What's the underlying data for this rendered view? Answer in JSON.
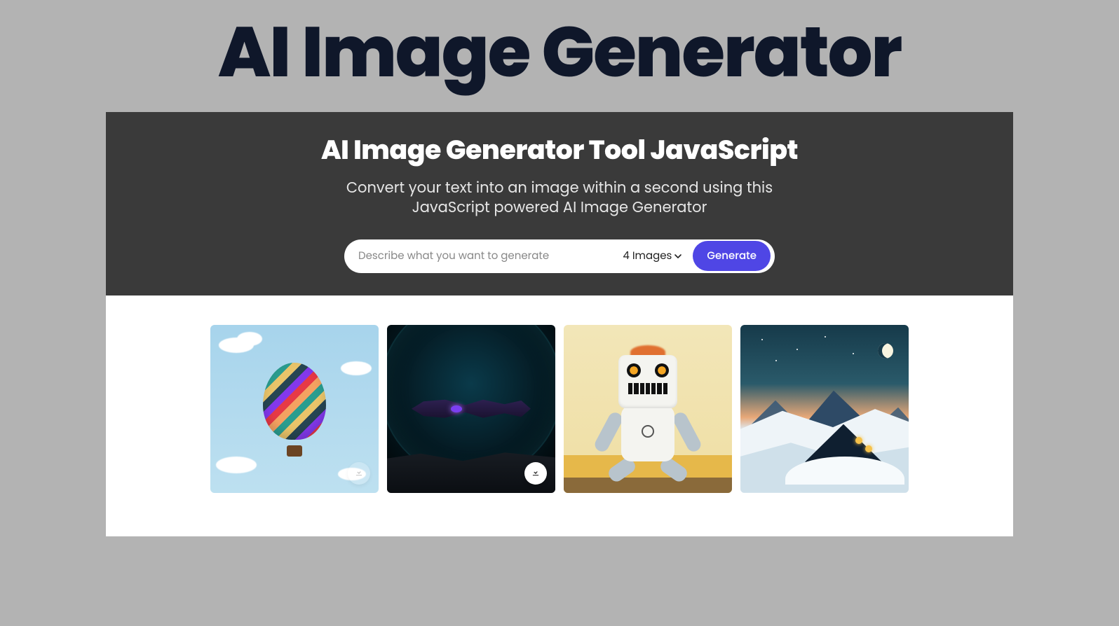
{
  "page": {
    "title": "AI Image Generator"
  },
  "hero": {
    "title": "AI Image Generator Tool JavaScript",
    "subtitle": "Convert your text into an image within a second using this JavaScript powered AI Image Generator"
  },
  "prompt": {
    "placeholder": "Describe what you want to generate",
    "value": "",
    "count_label": "4 Images",
    "generate_label": "Generate"
  },
  "gallery": {
    "items": [
      {
        "name": "hot-air-balloon",
        "download_visible": true,
        "download_faded": true
      },
      {
        "name": "purple-spaceship",
        "download_visible": true,
        "download_faded": false
      },
      {
        "name": "robot-plush",
        "download_visible": false,
        "download_faded": false
      },
      {
        "name": "night-cabin",
        "download_visible": false,
        "download_faded": false
      }
    ]
  },
  "icons": {
    "chevron_down": "chevron-down-icon",
    "download": "download-icon"
  },
  "colors": {
    "accent": "#4f46e5",
    "hero_bg": "#3a3a3a",
    "page_bg": "#b3b3b3",
    "title_color": "#0f172a"
  }
}
